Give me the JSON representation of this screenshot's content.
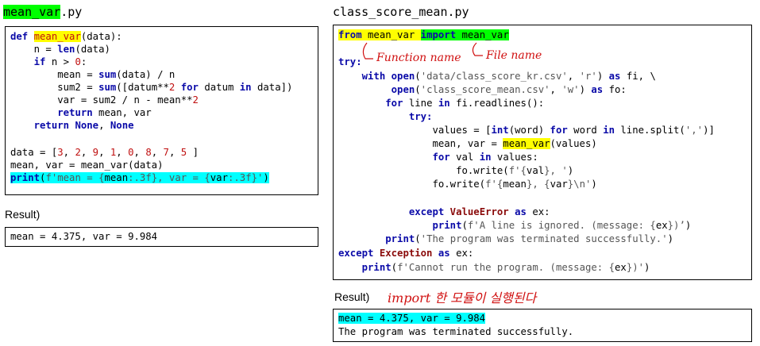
{
  "left": {
    "file_title_hl": "mean_var",
    "file_title_ext": ".py",
    "code": {
      "l1a": "def ",
      "l1b": "mean_var",
      "l1c": "(data):",
      "l2a": "    n = ",
      "l2b": "len",
      "l2c": "(data)",
      "l3a": "    ",
      "l3b": "if",
      "l3c": " n > ",
      "l3d": "0",
      "l3e": ":",
      "l4a": "        mean = ",
      "l4b": "sum",
      "l4c": "(data) / n",
      "l5a": "        sum2 = ",
      "l5b": "sum",
      "l5c": "([datum**",
      "l5d": "2",
      "l5e": " ",
      "l5f": "for",
      "l5g": " datum ",
      "l5h": "in",
      "l5i": " data])",
      "l6a": "        var = sum2 / n - mean**",
      "l6b": "2",
      "l7a": "        ",
      "l7b": "return",
      "l7c": " mean, var",
      "l8a": "    ",
      "l8b": "return",
      "l8c": " ",
      "l8d": "None",
      "l8e": ", ",
      "l8f": "None",
      "l9a": "data = [",
      "l9_nums": [
        "3",
        "2",
        "9",
        "1",
        "0",
        "8",
        "7",
        "5"
      ],
      "l9z": " ]",
      "l10": "mean, var = mean_var(data)",
      "l11a": "print",
      "l11b": "(",
      "l11c": "f'mean = {",
      "l11d": "mean",
      "l11e": ":.3f}, var = {",
      "l11f": "var",
      "l11g": ":.3f}'",
      "l11h": ")"
    },
    "result_label": "Result)",
    "result_text": "mean = 4.375, var = 9.984"
  },
  "right": {
    "file_title": "class_score_mean.py",
    "code": {
      "r1a": "from",
      "r1b": " mean_var ",
      "r1c": "import",
      "r1d": " mean_var",
      "r2": "try:",
      "r3a": "    ",
      "r3b": "with",
      "r3c": " ",
      "r3d": "open",
      "r3e": "(",
      "r3f": "'data/class_score_kr.csv'",
      "r3g": ", ",
      "r3h": "'r'",
      "r3i": ") ",
      "r3j": "as",
      "r3k": " fi, \\",
      "r4a": "         ",
      "r4b": "open",
      "r4c": "(",
      "r4d": "'class_score_mean.csv'",
      "r4e": ", ",
      "r4f": "'w'",
      "r4g": ") ",
      "r4h": "as",
      "r4i": " fo:",
      "r5a": "        ",
      "r5b": "for",
      "r5c": " line ",
      "r5d": "in",
      "r5e": " fi.readlines():",
      "r6a": "            ",
      "r6b": "try:",
      "r7a": "                values = [",
      "r7b": "int",
      "r7c": "(word) ",
      "r7d": "for",
      "r7e": " word ",
      "r7f": "in",
      "r7g": " line.split(",
      "r7h": "','",
      "r7i": ")]",
      "r8a": "                mean, var = ",
      "r8b": "mean_var",
      "r8c": "(values)",
      "r9a": "                ",
      "r9b": "for",
      "r9c": " val ",
      "r9d": "in",
      "r9e": " values:",
      "r10a": "                    fo.write(",
      "r10b": "f'{",
      "r10c": "val",
      "r10d": "}, '",
      "r10e": ")",
      "r11a": "                fo.write(",
      "r11b": "f'{",
      "r11c": "mean",
      "r11d": "}, {",
      "r11e": "var",
      "r11f": "}\\n'",
      "r11g": ")",
      "r12a": "            ",
      "r12b": "except",
      "r12c": " ",
      "r12d": "ValueError",
      "r12e": " ",
      "r12f": "as",
      "r12g": " ex:",
      "r13a": "                ",
      "r13b": "print",
      "r13c": "(",
      "r13d": "f'A line is ignored. (message: {",
      "r13e": "ex",
      "r13f": "})’",
      "r13g": ")",
      "r14a": "        ",
      "r14b": "print",
      "r14c": "(",
      "r14d": "'The program was terminated successfully.'",
      "r14e": ")",
      "r15a": "except",
      "r15b": " ",
      "r15c": "Exception",
      "r15d": " ",
      "r15e": "as",
      "r15f": " ex:",
      "r16a": "    ",
      "r16b": "print",
      "r16c": "(",
      "r16d": "f'Cannot run the program. (message: {",
      "r16e": "ex",
      "r16f": "})'",
      "r16g": ")"
    },
    "annot_function": "Function name",
    "annot_file": "File name",
    "result_label": "Result)",
    "result_annot": "import 한 모듈이 실행된다",
    "result_line1": "mean = 4.375, var = 9.984",
    "result_line2": "The program was terminated successfully."
  },
  "colors": {
    "keyword": "#0a0aa8",
    "number": "#c01010",
    "string": "#555555",
    "highlight_yellow": "#ffff00",
    "highlight_green": "#00ff00",
    "highlight_cyan": "#00ffff",
    "annotation": "#d01010"
  }
}
